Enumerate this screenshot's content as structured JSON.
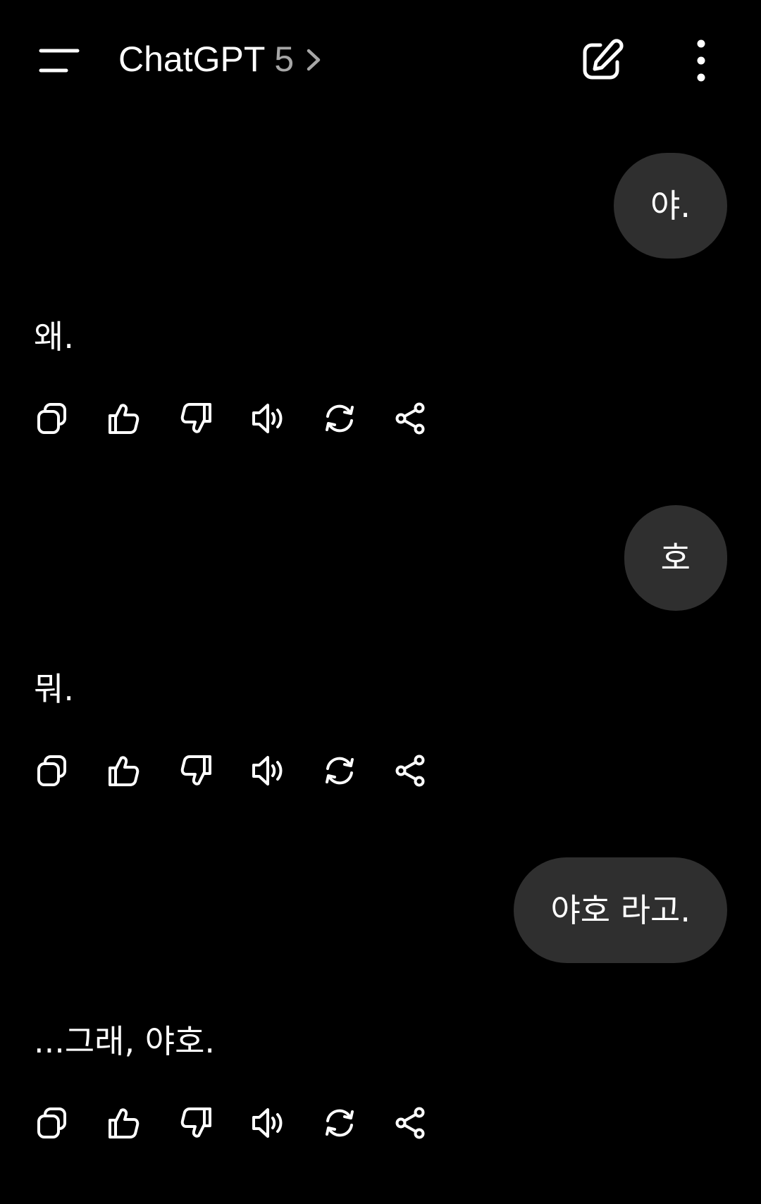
{
  "header": {
    "app_name": "ChatGPT",
    "model_version": "5",
    "menu_icon": "menu-icon",
    "chevron_icon": "chevron-right-icon",
    "new_chat_icon": "edit-icon",
    "more_icon": "more-vertical-icon"
  },
  "messages": [
    {
      "role": "user",
      "text": "야."
    },
    {
      "role": "assistant",
      "text": "왜."
    },
    {
      "role": "user",
      "text": "호"
    },
    {
      "role": "assistant",
      "text": "뭐."
    },
    {
      "role": "user",
      "text": "야호 라고."
    },
    {
      "role": "assistant",
      "text": "...그래, 야호."
    }
  ],
  "message_actions": [
    "copy-icon",
    "thumbs-up-icon",
    "thumbs-down-icon",
    "read-aloud-icon",
    "regenerate-icon",
    "share-icon"
  ],
  "colors": {
    "background": "#000000",
    "user_bubble": "#2f2f2f",
    "text": "#ffffff",
    "muted": "#a6a6a6"
  }
}
